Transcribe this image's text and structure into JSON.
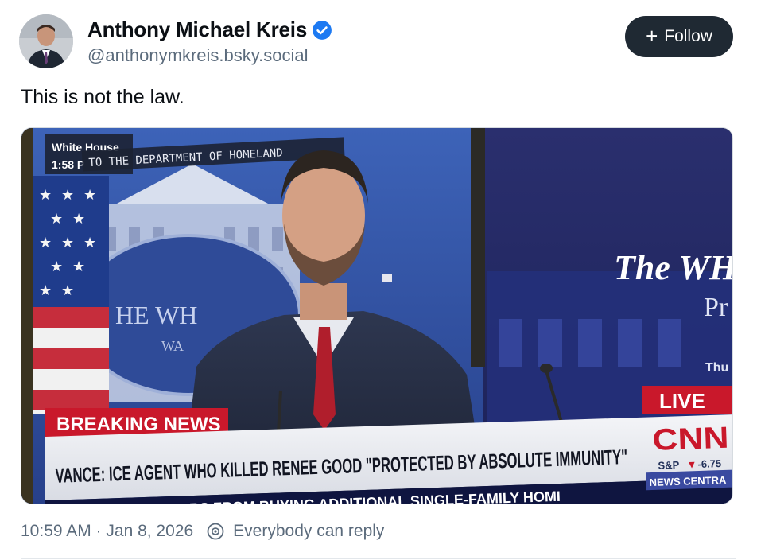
{
  "author": {
    "display_name": "Anthony Michael Kreis",
    "handle": "@anthonymkreis.bsky.social",
    "verified_icon": "verified-badge-icon"
  },
  "actions": {
    "follow_label": "Follow",
    "follow_icon": "plus-icon"
  },
  "post": {
    "text": "This is not the law."
  },
  "media": {
    "studio_label": "White House",
    "studio_time": "1:58 P",
    "studio_ticker": "TO THE DEPARTMENT OF HOMELAND",
    "backdrop_left": "HE WH",
    "backdrop_left_sub": "WA",
    "backdrop_right": "The WH",
    "backdrop_right_sub": "Pr",
    "backdrop_right_sub2": "Thu",
    "live_badge": "LIVE",
    "breaking_label": "BREAKING NEWS",
    "headline": "VANCE: ICE AGENT WHO KILLED RENEE GOOD \"PROTECTED BY ABSOLUTE IMMUNITY\"",
    "network_logo": "CNN",
    "market_label": "S&P",
    "market_change": "-6.75",
    "crawl_text": "VESTORS FROM BUYING ADDITIONAL SINGLE-FAMILY HOMI",
    "crawl_tag": "NEWS CENTRA"
  },
  "meta": {
    "timestamp": "10:59 AM · Jan 8, 2026",
    "reply_setting": "Everybody can reply",
    "reply_icon": "reply-restriction-icon"
  },
  "colors": {
    "follow_bg": "#1f2933",
    "verified": "#1d7af2",
    "muted_text": "#5b6b7c",
    "breaking_red": "#c9182b"
  }
}
